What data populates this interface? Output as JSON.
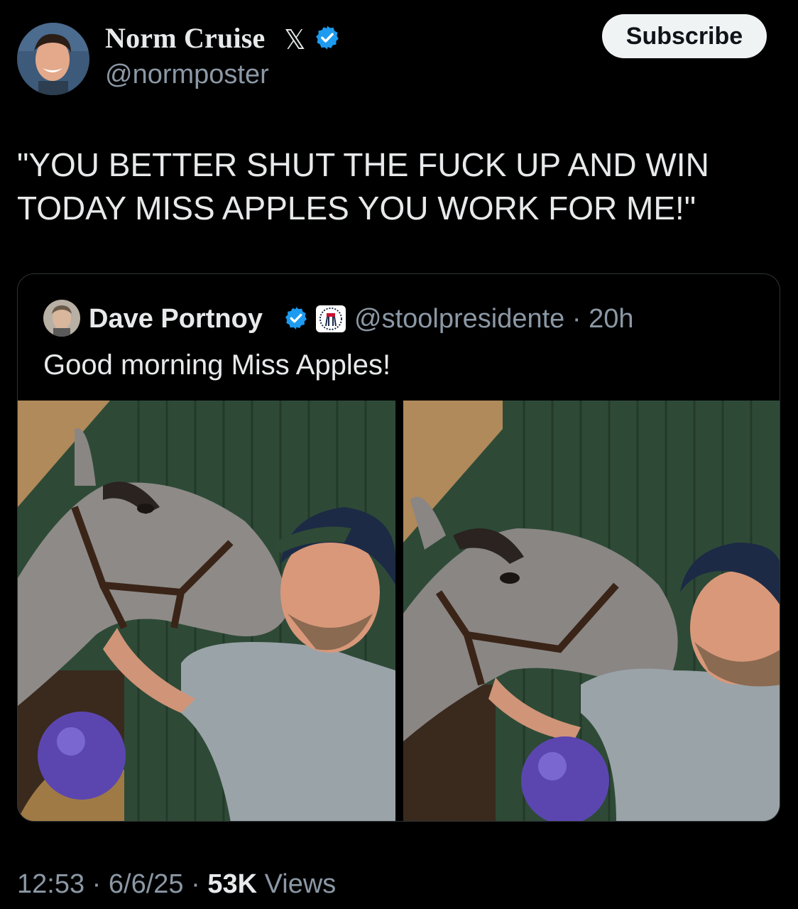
{
  "author": {
    "name": "Norm Cruise",
    "handle": "@normposter",
    "x_glyph": "𝕏",
    "verified_icon": "verified-badge-icon"
  },
  "subscribe_label": "Subscribe",
  "tweet_text": "\"YOU BETTER SHUT THE FUCK UP AND WIN TODAY MISS APPLES YOU WORK FOR ME!\"",
  "quoted": {
    "name": "Dave Portnoy",
    "handle": "@stoolpresidente",
    "separator": "·",
    "time": "20h",
    "text": "Good morning Miss Apples!",
    "affiliate_icon": "barstool-logo-icon"
  },
  "meta": {
    "time": "12:53",
    "sep1": "·",
    "date": "6/6/25",
    "sep2": "·",
    "views_count": "53K",
    "views_label": "Views"
  },
  "colors": {
    "background": "#000000",
    "text": "#e7e9ea",
    "secondary": "#8b98a5",
    "verified": "#1d9bf0",
    "border": "#2f3336"
  }
}
